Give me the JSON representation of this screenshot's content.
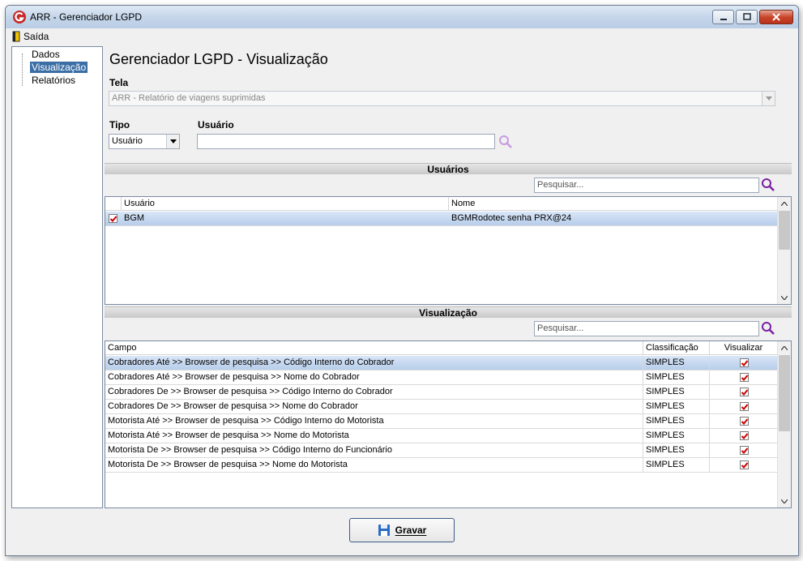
{
  "window": {
    "title": "ARR - Gerenciador LGPD"
  },
  "menu": {
    "saida_label": "Saída"
  },
  "tree": {
    "items": [
      "Dados",
      "Visualização",
      "Relatórios"
    ],
    "selected": 1
  },
  "page": {
    "title": "Gerenciador LGPD - Visualização"
  },
  "tela": {
    "label": "Tela",
    "value": "ARR - Relatório de viagens suprimidas"
  },
  "tipo": {
    "label": "Tipo",
    "value": "Usuário"
  },
  "usuario": {
    "label": "Usuário",
    "value": ""
  },
  "usuarios_section": {
    "title": "Usuários",
    "search_placeholder": "Pesquisar...",
    "columns": [
      "Usuário",
      "Nome"
    ],
    "rows": [
      {
        "checked": true,
        "usuario": "BGM",
        "nome": "BGMRodotec senha PRX@24"
      }
    ]
  },
  "visualizacao_section": {
    "title": "Visualização",
    "search_placeholder": "Pesquisar...",
    "columns": [
      "Campo",
      "Classificação",
      "Visualizar"
    ],
    "rows": [
      {
        "campo": "Cobradores Até >> Browser de pesquisa >> Código Interno do Cobrador",
        "classificacao": "SIMPLES",
        "visualizar": true
      },
      {
        "campo": "Cobradores Até >> Browser de pesquisa >> Nome do Cobrador",
        "classificacao": "SIMPLES",
        "visualizar": true
      },
      {
        "campo": "Cobradores De >> Browser de pesquisa >> Código Interno do Cobrador",
        "classificacao": "SIMPLES",
        "visualizar": true
      },
      {
        "campo": "Cobradores De >> Browser de pesquisa >> Nome do Cobrador",
        "classificacao": "SIMPLES",
        "visualizar": true
      },
      {
        "campo": "Motorista Até >> Browser de pesquisa >> Código Interno do Motorista",
        "classificacao": "SIMPLES",
        "visualizar": true
      },
      {
        "campo": "Motorista Até >> Browser de pesquisa >> Nome do Motorista",
        "classificacao": "SIMPLES",
        "visualizar": true
      },
      {
        "campo": "Motorista De >> Browser de pesquisa >> Código Interno do Funcionário",
        "classificacao": "SIMPLES",
        "visualizar": true
      },
      {
        "campo": "Motorista De >> Browser de pesquisa >> Nome do Motorista",
        "classificacao": "SIMPLES",
        "visualizar": true
      }
    ]
  },
  "actions": {
    "gravar_label": "Gravar"
  },
  "colors": {
    "accent": "#3a6ea5",
    "checkbox_mark": "#cc0000",
    "search_icon": "#7a1fa2",
    "selected_row": "#b7cdea"
  }
}
